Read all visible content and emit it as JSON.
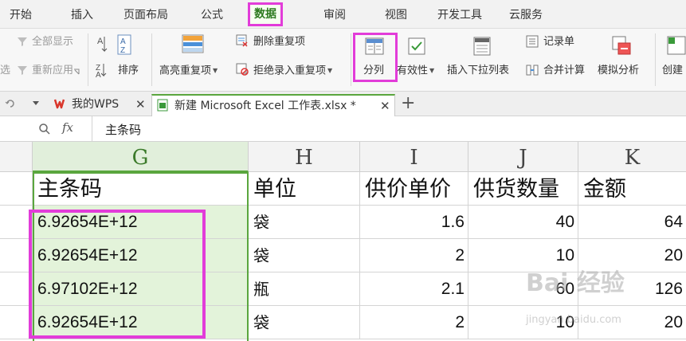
{
  "menu_tabs": [
    "开始",
    "插入",
    "页面布局",
    "公式",
    "数据",
    "审阅",
    "视图",
    "开发工具",
    "云服务"
  ],
  "ribbon": {
    "show_all": "全部显示",
    "reapply": "重新应用",
    "cut_left_top": "选",
    "sort": "排序",
    "highlight_duplicates": "高亮重复项",
    "delete_duplicates": "删除重复项",
    "reject_duplicates": "拒绝录入重复项",
    "split_columns": "分列",
    "validity": "有效性",
    "insert_dropdown": "插入下拉列表",
    "record_form": "记录单",
    "consolidate": "合并计算",
    "what_if": "模拟分析",
    "create_cut": "创建"
  },
  "doc_tabs": {
    "home": "我的WPS",
    "current_file": "新建 Microsoft Excel 工作表.xlsx *"
  },
  "formula_bar": {
    "fx_label": "fx",
    "content": "主条码"
  },
  "grid": {
    "columns": [
      "G",
      "H",
      "I",
      "J",
      "K"
    ],
    "headers": [
      "主条码",
      "单位",
      "供价单价",
      "供货数量",
      "金额"
    ],
    "rows": [
      [
        "6.92654E+12",
        "袋",
        "1.6",
        "40",
        "64"
      ],
      [
        "6.92654E+12",
        "袋",
        "2",
        "10",
        "20"
      ],
      [
        "6.97102E+12",
        "瓶",
        "2.1",
        "60",
        "126"
      ],
      [
        "6.92654E+12",
        "袋",
        "2",
        "10",
        "20"
      ]
    ]
  },
  "watermark": {
    "brand": "Bai 经验",
    "url": "jingyan.baidu.com"
  },
  "colors": {
    "highlight": "#e23cd9",
    "selection_green": "#5aa63e",
    "selection_fill": "#e3f3da"
  }
}
